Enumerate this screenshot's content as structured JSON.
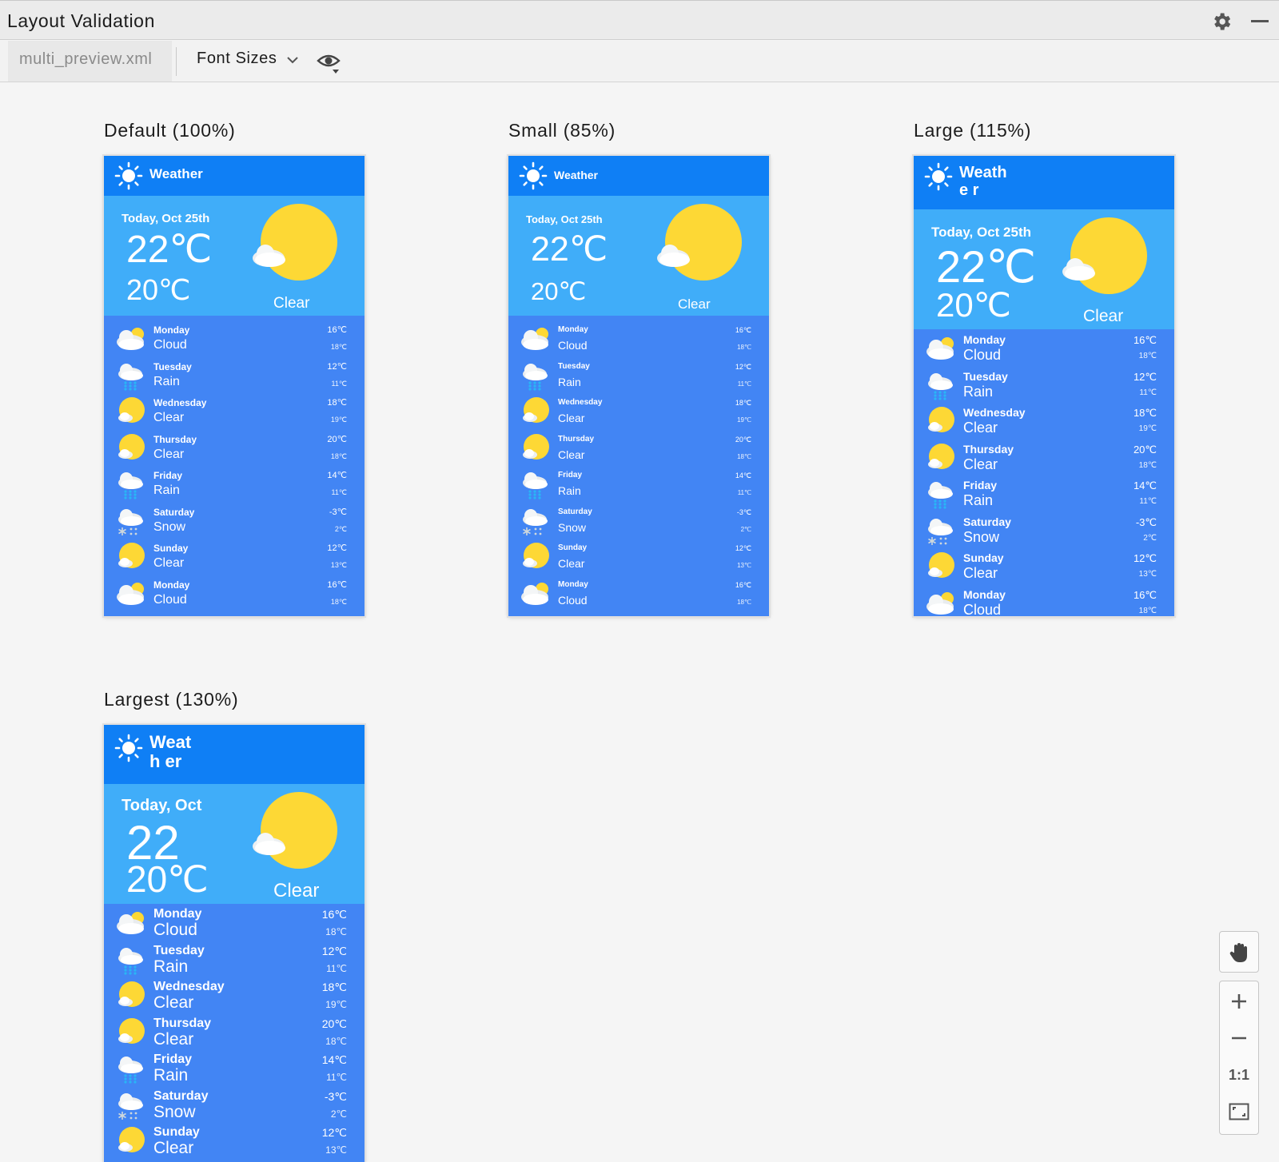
{
  "window": {
    "title": "Layout Validation"
  },
  "toolbar": {
    "file_tab": "multi_preview.xml",
    "dropdown_label": "Font Sizes"
  },
  "previews": [
    {
      "label": "Default (100%)",
      "app_title": "Weather",
      "date": "Today, Oct 25th",
      "high": "22℃",
      "low": "20℃",
      "condition": "Clear"
    },
    {
      "label": "Small (85%)",
      "app_title": "Weather",
      "date": "Today, Oct 25th",
      "high": "22℃",
      "low": "20℃",
      "condition": "Clear"
    },
    {
      "label": "Large (115%)",
      "app_title": "Weathe r",
      "date": "Today, Oct 25th",
      "high": "22℃",
      "low": "20℃",
      "condition": "Clear"
    },
    {
      "label": "Largest (130%)",
      "app_title": "Weath er",
      "date": "Today, Oct",
      "high": "22",
      "low": "20℃",
      "condition": "Clear"
    }
  ],
  "forecast": [
    {
      "day": "Monday",
      "cond": "Cloud",
      "hi": "16℃",
      "lo": "18℃",
      "icon": "cloud"
    },
    {
      "day": "Tuesday",
      "cond": "Rain",
      "hi": "12℃",
      "lo": "11℃",
      "icon": "rain"
    },
    {
      "day": "Wednesday",
      "cond": "Clear",
      "hi": "18℃",
      "lo": "19℃",
      "icon": "clear"
    },
    {
      "day": "Thursday",
      "cond": "Clear",
      "hi": "20℃",
      "lo": "18℃",
      "icon": "clear"
    },
    {
      "day": "Friday",
      "cond": "Rain",
      "hi": "14℃",
      "lo": "11℃",
      "icon": "rain"
    },
    {
      "day": "Saturday",
      "cond": "Snow",
      "hi": "-3℃",
      "lo": "2℃",
      "icon": "snow"
    },
    {
      "day": "Sunday",
      "cond": "Clear",
      "hi": "12℃",
      "lo": "13℃",
      "icon": "clear"
    },
    {
      "day": "Monday",
      "cond": "Cloud",
      "hi": "16℃",
      "lo": "18℃",
      "icon": "cloud"
    }
  ],
  "zoom_controls": {
    "actual_size_label": "1:1"
  },
  "colors": {
    "app_bar": "#0f7ff5",
    "hero": "#40adf9",
    "list": "#4285f4",
    "sun": "#fdd835"
  },
  "icons": [
    "gear-icon",
    "minimize-icon",
    "chevron-down-icon",
    "eye-icon",
    "hand-icon",
    "zoom-in-icon",
    "zoom-out-icon",
    "fit-screen-icon",
    "sun-icon"
  ]
}
